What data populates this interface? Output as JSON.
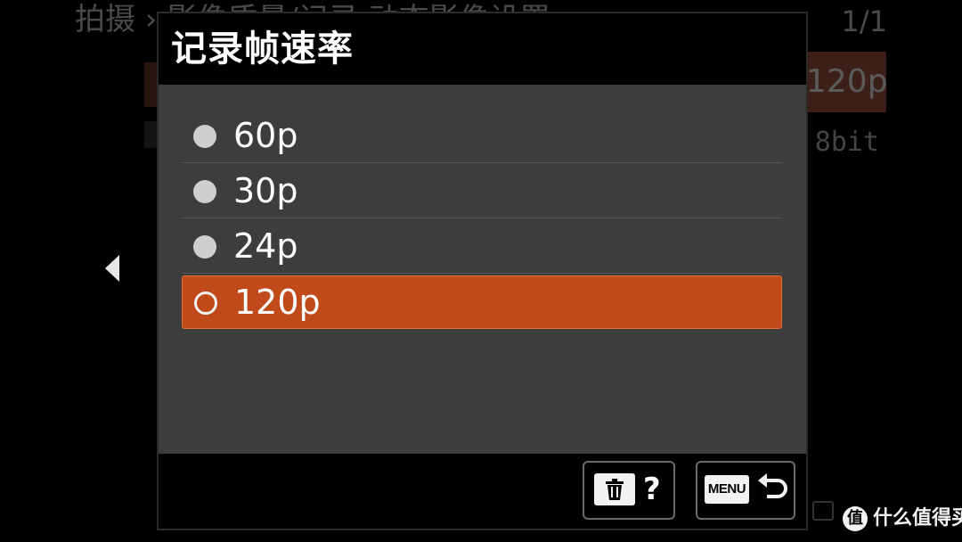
{
  "background_menu": {
    "header": "拍摄 › 影像质量/记录      动态影像设置",
    "page_indicator": "1/1",
    "values": [
      "120p",
      "8bit"
    ]
  },
  "dialog": {
    "title": "记录帧速率",
    "options": [
      {
        "label": "60p",
        "selected": false
      },
      {
        "label": "30p",
        "selected": false
      },
      {
        "label": "24p",
        "selected": false
      },
      {
        "label": "120p",
        "selected": true
      }
    ],
    "footer": {
      "delete_help_label": "?",
      "menu_label": "MENU"
    }
  },
  "icons": {
    "left_arrow": "chevron-left-icon",
    "trash": "trash-icon",
    "back": "back-arrow-icon"
  },
  "colors": {
    "selection": "#c04a1a",
    "dialog_bg": "#3d3d3d",
    "title_bar": "#000000"
  },
  "watermark": {
    "badge": "值",
    "text": "什么值得买"
  }
}
